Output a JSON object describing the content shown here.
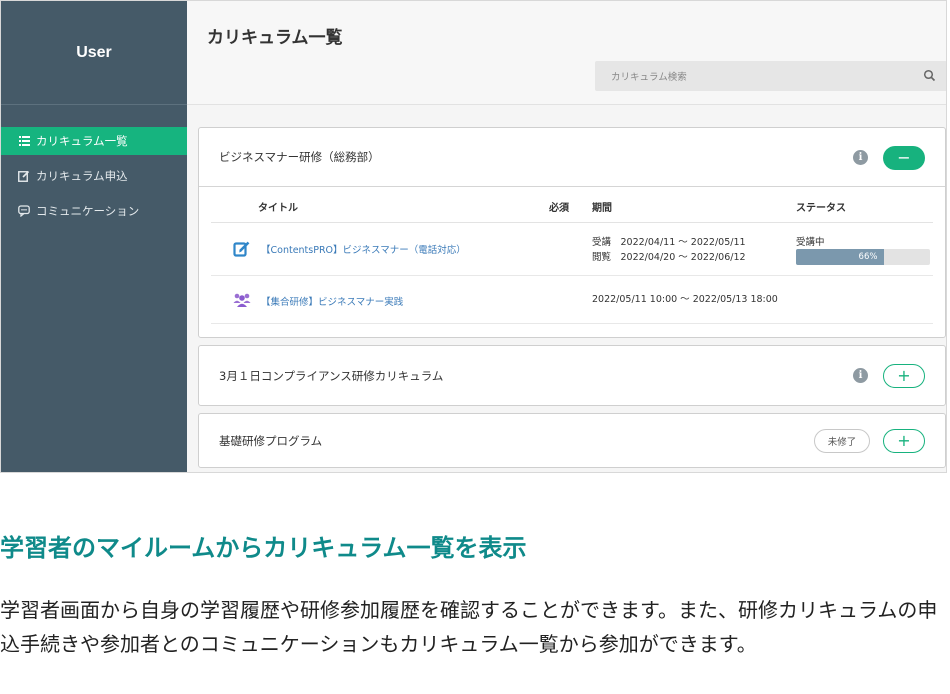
{
  "sidebar": {
    "user_label": "User",
    "items": [
      {
        "label": "カリキュラム一覧",
        "icon": "list-icon",
        "active": true
      },
      {
        "label": "カリキュラム申込",
        "icon": "edit-icon",
        "active": false
      },
      {
        "label": "コミュニケーション",
        "icon": "chat-icon",
        "active": false
      }
    ]
  },
  "header": {
    "title": "カリキュラム一覧",
    "search_placeholder": "カリキュラム検索",
    "search_icon": "search-icon"
  },
  "curricula": [
    {
      "title": "ビジネスマナー研修（総務部）",
      "expanded": true,
      "toggle_label": "−",
      "table": {
        "headers": {
          "title": "タイトル",
          "required": "必須",
          "period": "期間",
          "status": "ステータス"
        },
        "rows": [
          {
            "icon": "edit-note-icon",
            "title": "【ContentsPRO】ビジネスマナー（電話対応）",
            "period_line1": "受講　2022/04/11 ～ 2022/05/11",
            "period_line2": "閲覧　2022/04/20 ～ 2022/06/12",
            "status": "受講中",
            "progress_label": "66%",
            "progress": 0.66
          },
          {
            "icon": "group-icon",
            "title": "【集合研修】ビジネスマナー実践",
            "period_line1": "2022/05/11 10:00 ～ 2022/05/13 18:00"
          }
        ]
      }
    },
    {
      "title": "3月１日コンプライアンス研修カリキュラム",
      "expanded": false,
      "toggle_label": "+"
    },
    {
      "title": "基礎研修プログラム",
      "expanded": false,
      "badge": "未修了",
      "toggle_label": "+"
    }
  ],
  "info_label": "i",
  "headline": "学習者のマイルームからカリキュラム一覧を表示",
  "description": "学習者画面から自身の学習履歴や研修参加履歴を確認することができます。また、研修カリキュラムの申込手続きや参加者とのコミュニケーションもカリキュラム一覧から参加ができます。",
  "colors": {
    "sidebar": "#455a68",
    "accent": "#16b47f",
    "headline": "#0f8a8a",
    "link": "#3a7ab8"
  }
}
